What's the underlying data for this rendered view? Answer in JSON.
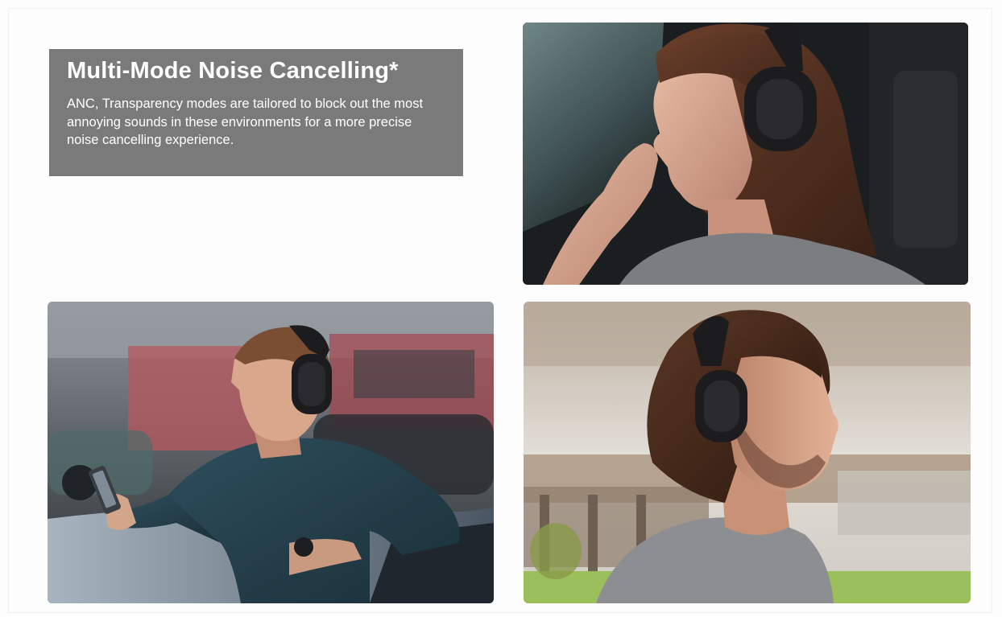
{
  "feature": {
    "title": "Multi-Mode Noise Cancelling*",
    "description": "ANC, Transparency modes are tailored to block out the most annoying sounds in these environments for a more precise noise cancelling experience."
  },
  "colors": {
    "card_background": "#7a7a7a",
    "text": "#ffffff",
    "headphones": "#1c1c1e"
  },
  "icons": {
    "headphones": "headphones-icon",
    "phone": "phone-icon",
    "watch": "watch-icon"
  }
}
